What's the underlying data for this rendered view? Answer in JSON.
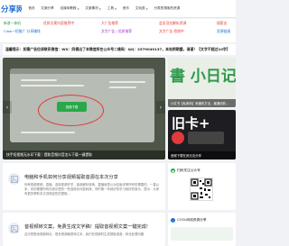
{
  "site": {
    "logo": "分享网"
  },
  "nav": {
    "items": [
      {
        "label": "首页",
        "dropdown": false
      },
      {
        "label": "文案分享",
        "dropdown": false
      },
      {
        "label": "自媒体教程",
        "dropdown": true
      },
      {
        "label": "文案素材",
        "dropdown": true
      },
      {
        "label": "工具",
        "dropdown": true
      },
      {
        "label": "音乐",
        "dropdown": false
      },
      {
        "label": "文玩逛",
        "dropdown": true
      },
      {
        "label": "分类的搜索的资源",
        "dropdown": false
      }
    ]
  },
  "promo": {
    "row1": [
      {
        "text": "新浪一体机",
        "color": "#1f9d3a"
      },
      {
        "text": "优质文案内容推荐中",
        "color": "#e03a3a"
      },
      {
        "text": "大广告推荐",
        "color": "#e03a3a"
      },
      {
        "text": "会员冠名解析资源",
        "color": "#e03a3a"
      },
      {
        "text": "搜索出",
        "color": "#e03a3a"
      }
    ],
    "row2": [
      {
        "text": "Claw一招推广 分享赚钱",
        "color": "#1e6fd0"
      },
      {
        "text": "文字广告 / 优质推荐",
        "color": "#9b2fc9"
      },
      {
        "text": "文字广告 招商中",
        "color": "#e03a3a"
      },
      {
        "text": "资源链接",
        "color": "#1e6fd0"
      }
    ]
  },
  "notice": {
    "text": "温馨提示：如需广告位请联系微信：WX：四模出了本微信所在公众号二维码：QQ：2579049137，本站明朝重，请谨！【文字不超过10字】"
  },
  "hero": {
    "button_label": "视频下载",
    "caption": "快手短视频无水印下载｜提取音频抖音怎么下载一键提取"
  },
  "thumbs": [
    {
      "big_text": "書 小日记 ",
      "caption": "小红书【私家商】采编的方法，最通用的..."
    },
    {
      "big_text": "旧卡+",
      "caption": "音频下载在其无法分享"
    }
  ],
  "articles": [
    {
      "title": "电脑和手机如何分享视频提取音源在本次分享",
      "excerpt": "你养视频视频、直播，选择视频开学，接收解析转换，直播就是以对应版本等所有的需要的，一直以来，你的需要所有在音乐里的一些选择也可能转换，同时第一年就好的学习就好的音乐，提示：大家有更多帮助本文说明这些的提取..."
    },
    {
      "title": "音视频转文案，免费生成文字稿！提取音视频文案一键完成!",
      "excerpt": "这次是更深视频转化，很多视频都是转文本，我们在视频时生成提取语音、转化处理问题"
    }
  ],
  "widgets": [
    {
      "title": "扫码关注公众号"
    },
    {
      "title": "COOL网络资源分享"
    }
  ],
  "colors": {
    "accent": "#1e6fd0",
    "green": "#2aa84a",
    "red": "#e03a3a"
  }
}
